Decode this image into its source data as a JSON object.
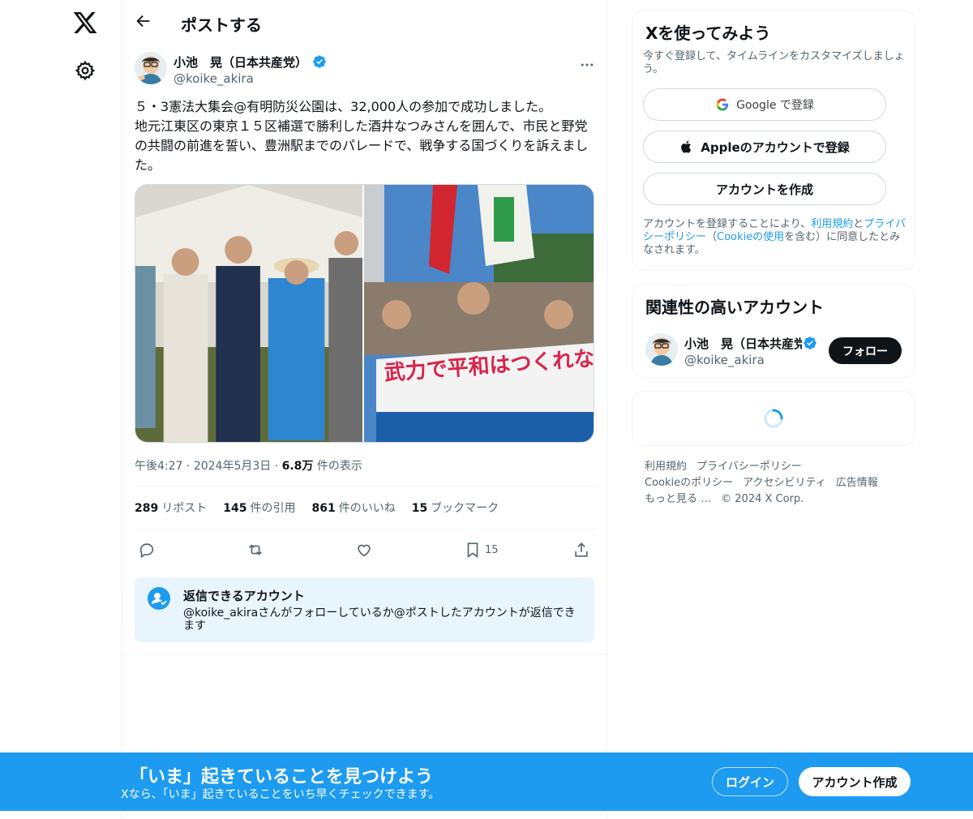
{
  "colors": {
    "accent": "#1d9bf0",
    "text": "#0f1419",
    "muted": "#536471"
  },
  "header": {
    "title": "ポストする"
  },
  "tweet": {
    "author_name": "小池　晃（日本共産党）",
    "author_handle": "@koike_akira",
    "text": "５・3憲法大集会@有明防災公園は、32,000人の参加で成功しました。\n地元江東区の東京１５区補選で勝利した酒井なつみさんを囲んで、市民と野党の共闘の前進を誓い、豊洲駅までのパレードで、戦争する国づくりを訴えました。",
    "time": "午後4:27",
    "date": "2024年5月3日",
    "views_count": "6.8万",
    "views_label": "件の表示",
    "stats": {
      "reposts": "289",
      "reposts_label": "リポスト",
      "quotes": "145",
      "quotes_label": "件の引用",
      "likes": "861",
      "likes_label": "件のいいね",
      "bookmarks": "15",
      "bookmarks_label": "ブックマーク"
    },
    "bookmark_count": "15",
    "media": [
      {
        "label": "group-photo-tent",
        "banner_text": ""
      },
      {
        "label": "parade-photo",
        "banner_text": "武力で平和はつくれない"
      }
    ]
  },
  "reply_box": {
    "title": "返信できるアカウント",
    "desc": "@koike_akiraさんがフォローしているか@ポストしたアカウントが返信できます"
  },
  "signup_card": {
    "title": "Xを使ってみよう",
    "subtitle": "今すぐ登録して、タイムラインをカスタマイズしましょう。",
    "google_label": "Google で登録",
    "apple_label": "Appleのアカウントで登録",
    "create_label": "アカウントを作成",
    "legal_prefix": "アカウントを登録することにより、",
    "legal_terms": "利用規約",
    "legal_and": "と",
    "legal_privacy": "プライバシーポリシー",
    "legal_mid": "（",
    "legal_cookie": "Cookieの使用",
    "legal_suffix": "を含む）に同意したとみなされます。"
  },
  "related": {
    "title": "関連性の高いアカウント",
    "name": "小池　晃（日本共産党）",
    "handle": "@koike_akira",
    "follow_label": "フォロー"
  },
  "footer": {
    "links": [
      "利用規約",
      "プライバシーポリシー",
      "Cookieのポリシー",
      "アクセシビリティ",
      "広告情報",
      "もっと見る …"
    ],
    "copyright": "© 2024 X Corp."
  },
  "banner": {
    "title": "「いま」起きていることを見つけよう",
    "subtitle": "Xなら、「いま」起きていることをいち早くチェックできます。",
    "login_label": "ログイン",
    "signup_label": "アカウント作成"
  }
}
